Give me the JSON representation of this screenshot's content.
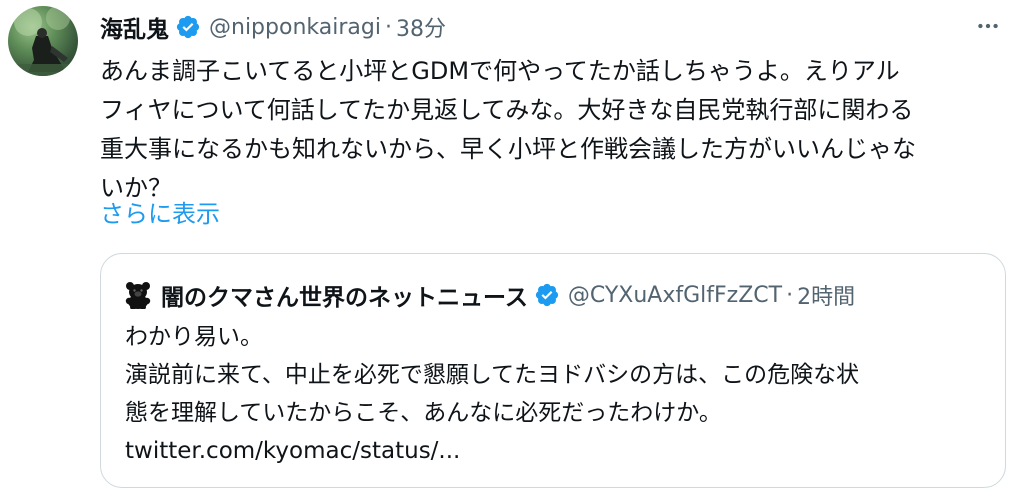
{
  "tweet": {
    "author": {
      "display_name": "海乱鬼",
      "handle": "@nipponkairagi",
      "verified": true
    },
    "separator": "·",
    "timestamp": "38分",
    "text_lines": [
      "あんま調子こいてると小坪とGDMで何やってたか話しちゃうよ。えりアル",
      "フィヤについて何話してたか見返してみな。大好きな自民党執行部に関わる",
      "重大事になるかも知れないから、早く小坪と作戦会議した方がいいんじゃな",
      "いか？"
    ],
    "show_more_label": "さらに表示",
    "more_icon": "more-horizontal-icon"
  },
  "quoted_tweet": {
    "author": {
      "display_name": "闇のクマさん世界のネットニュース",
      "handle": "@CYXuAxfGlfFzZCT",
      "verified": true,
      "emoji": "bear-icon"
    },
    "separator": "·",
    "timestamp": "2時間",
    "text_lines": [
      "わかり易い。",
      "演説前に来て、中止を必死で懇願してたヨドバシの方は、この危険な状",
      "態を理解していたからこそ、あんなに必死だったわけか。"
    ],
    "link_text": "twitter.com/kyomac/status/..."
  },
  "colors": {
    "text_primary": "#0f1419",
    "text_secondary": "#536471",
    "link": "#1d9bf0",
    "verified_badge": "#1d9bf0",
    "border": "#cfd9de",
    "background": "#ffffff"
  }
}
